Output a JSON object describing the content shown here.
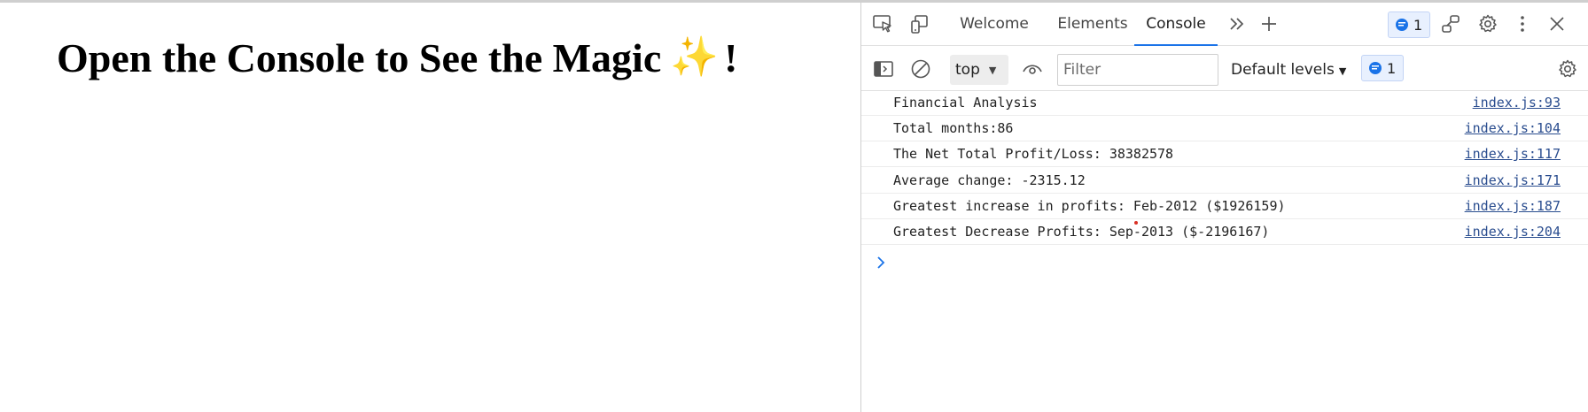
{
  "page": {
    "heading": "Open the Console to See the Magic",
    "sparkle": "✨",
    "bang": "!"
  },
  "devtools": {
    "tabs": [
      {
        "label": "Welcome",
        "active": false
      },
      {
        "label": "Elements",
        "active": false
      },
      {
        "label": "Console",
        "active": true
      }
    ],
    "issues_count": "1",
    "toolbar": {
      "context": "top",
      "filter_placeholder": "Filter",
      "levels_label": "Default levels",
      "messages_count": "1"
    },
    "console": {
      "rows": [
        {
          "message": "Financial Analysis",
          "source": "index.js:93"
        },
        {
          "message": "Total months:86",
          "source": "index.js:104"
        },
        {
          "message": "The Net Total Profit/Loss: 38382578",
          "source": "index.js:117"
        },
        {
          "message": "Average change: -2315.12",
          "source": "index.js:171"
        },
        {
          "message": "Greatest increase in profits: Feb-2012 ($1926159)",
          "source": "index.js:187"
        },
        {
          "message": "Greatest Decrease Profits: Sep-2013 ($-2196167)",
          "source": "index.js:204"
        }
      ]
    }
  },
  "colors": {
    "accent": "#1a73e8",
    "link": "#2a4d8f",
    "sparkle": "#f4b400"
  }
}
